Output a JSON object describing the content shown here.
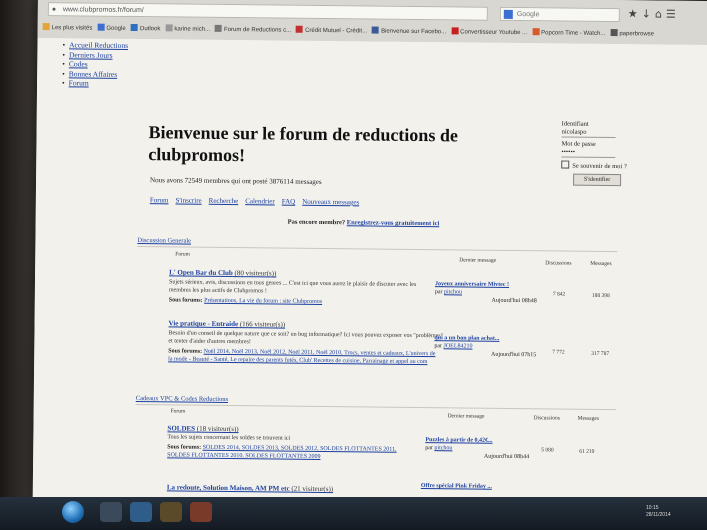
{
  "browser": {
    "address": "www.clubpromos.fr/forum/",
    "search_placeholder": "Google",
    "bookmarks": [
      {
        "label": "Les plus visités",
        "color": "#e5a43a"
      },
      {
        "label": "Google",
        "color": "#3b6fd1"
      },
      {
        "label": "Outlook",
        "color": "#2f6fc2"
      },
      {
        "label": "karine mich...",
        "color": "#999999"
      },
      {
        "label": "Forum de Reductions c...",
        "color": "#777777"
      },
      {
        "label": "Crédit Mutuel - Crédit...",
        "color": "#c43030"
      },
      {
        "label": "Bienvenue sur Facebo...",
        "color": "#3a5a98"
      },
      {
        "label": "Convertisseur Youtube ...",
        "color": "#c62020"
      },
      {
        "label": "Popcorn Time - Watch...",
        "color": "#d85a2a"
      },
      {
        "label": "paperbrowse",
        "color": "#555555"
      }
    ]
  },
  "topnav": [
    "Accueil Reductions",
    "Derniers Jours",
    "Codes",
    "Bonnes Affaires",
    "Forum"
  ],
  "welcome": {
    "title": "Bienvenue sur le forum de reductions de clubpromos!",
    "stats": "Nous avons 72549 membres qui ont posté 3876114 messages"
  },
  "menu": [
    "Forum",
    "S'inscrire",
    "Recherche",
    "Calendrier",
    "FAQ",
    "Nouveaux messages"
  ],
  "not_member": {
    "text": "Pas encore membre?",
    "link": "Enregistrez-vous gratuitement ici"
  },
  "login": {
    "id_label": "Identifiant",
    "id_value": "nicolaspo",
    "pw_label": "Mot de passe",
    "pw_value": "••••••",
    "remember": "Se souvenir de moi ?",
    "button": "S'identifier"
  },
  "sections": [
    {
      "title": "Discussion Generale",
      "headers": {
        "forum": "Forum",
        "last": "Dernier message",
        "discussions": "Discussions",
        "messages": "Messages"
      },
      "forums": [
        {
          "title": "L' Open Bar du Club",
          "viewers": "(80 visiteur(s))",
          "desc": "Sujets sérieux, avis, discussions en tous genres ... C'est ici que vous aurez le plaisir de discuter avec les membres les plus actifs de Clubpromos !",
          "subs_label": "Sous forums:",
          "subs": "Présentations, La vie du forum : site Clubpromos",
          "last_title": "Joyeux anniversaire Mivtec !",
          "last_by": "par",
          "last_author": "pitchou",
          "last_time": "Aujourd'hui 08h48",
          "discussions": "7 842",
          "messages": "188 398"
        },
        {
          "title": "Vie pratique - Entraide",
          "viewers": "(166 visiteur(s))",
          "desc": "Besoin d'un conseil de quelque nature que ce soit? un bug informatique? Ici vous pouvez exposer vos \"problèmes\" et tenter d'aider d'autres membres!",
          "subs_label": "Sous forums:",
          "subs": "Noël 2014, Noël 2013, Noël 2012, Noël 2011, Noël 2010, Trocs, ventes et cadeaux, L'univers de la mode - Beauté - Santé, Le repaire des parents futés, Club' Recettes de cuisine, Parrainage et appel au com",
          "last_title": "qui a un bon plan achat...",
          "last_by": "par",
          "last_author": "JOEL84210",
          "last_time": "Aujourd'hui 07h15",
          "discussions": "7 772",
          "messages": "317 787"
        }
      ]
    },
    {
      "title": "Cadeaux VPC & Codes Reductions",
      "headers": {
        "forum": "Forum",
        "last": "Dernier message",
        "discussions": "Discussions",
        "messages": "Messages"
      },
      "forums": [
        {
          "title": "SOLDES",
          "viewers": "(18 visiteur(s))",
          "desc": "Tous les sujets concernant les soldes se trouvent ici",
          "subs_label": "Sous forums:",
          "subs": "SOLDES 2014, SOLDES 2013, SOLDES 2012, SOLDES FLOTTANTES 2011, SOLDES FLOTTANTES 2010, SOLDES FLOTTANTES 2009",
          "last_title": "Puzzles à partir de 0,42€...",
          "last_by": "par",
          "last_author": "pitchou",
          "last_time": "Aujourd'hui 08h44",
          "discussions": "5 080",
          "messages": "61 219"
        },
        {
          "title": "La redoute, Solution Maison, AM PM etc",
          "viewers": "(21 visiteur(s))",
          "last_title": "Offre spécial Pink Friday ..."
        }
      ]
    }
  ],
  "clock": {
    "time": "10:15",
    "date": "28/11/2014"
  }
}
